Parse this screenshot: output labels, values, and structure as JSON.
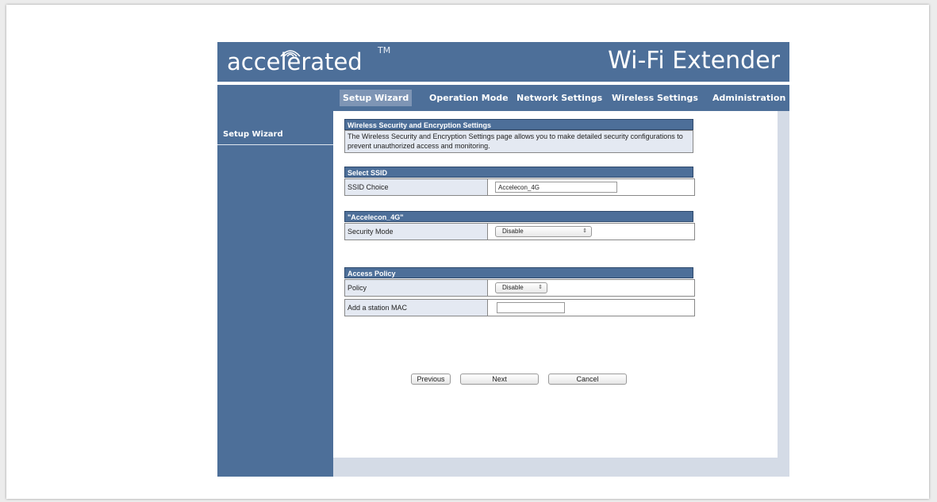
{
  "header": {
    "logo_text": "accelerated",
    "trademark": "TM",
    "product_title": "Wi-Fi Extender"
  },
  "nav": {
    "items": [
      {
        "label": "Setup Wizard",
        "active": true
      },
      {
        "label": "Operation Mode"
      },
      {
        "label": "Network Settings"
      },
      {
        "label": "Wireless Settings"
      },
      {
        "label": "Administration"
      }
    ]
  },
  "sidebar": {
    "items": [
      {
        "label": "Setup Wizard"
      }
    ]
  },
  "security_section": {
    "title": "Wireless Security and Encryption Settings",
    "description": "The Wireless Security and Encryption Settings page allows you to make detailed security configurations to prevent unauthorized access and monitoring."
  },
  "ssid_section": {
    "title": "Select SSID",
    "label": "SSID Choice",
    "value": "Accelecon_4G"
  },
  "mode_section": {
    "title": "\"Accelecon_4G\"",
    "label": "Security Mode",
    "value": "Disable"
  },
  "policy_section": {
    "title": "Access Policy",
    "policy_label": "Policy",
    "policy_value": "Disable",
    "mac_label": "Add a station MAC",
    "mac_value": ""
  },
  "buttons": {
    "previous": "Previous",
    "next": "Next",
    "cancel": "Cancel"
  },
  "colors": {
    "brand_blue": "#4d6f99",
    "active_tab": "#7e95b5",
    "label_bg": "#e4e9f2"
  },
  "icons": {
    "logo_wifi": "wifi-arcs-icon",
    "select_arrow": "updown-arrow-icon"
  }
}
